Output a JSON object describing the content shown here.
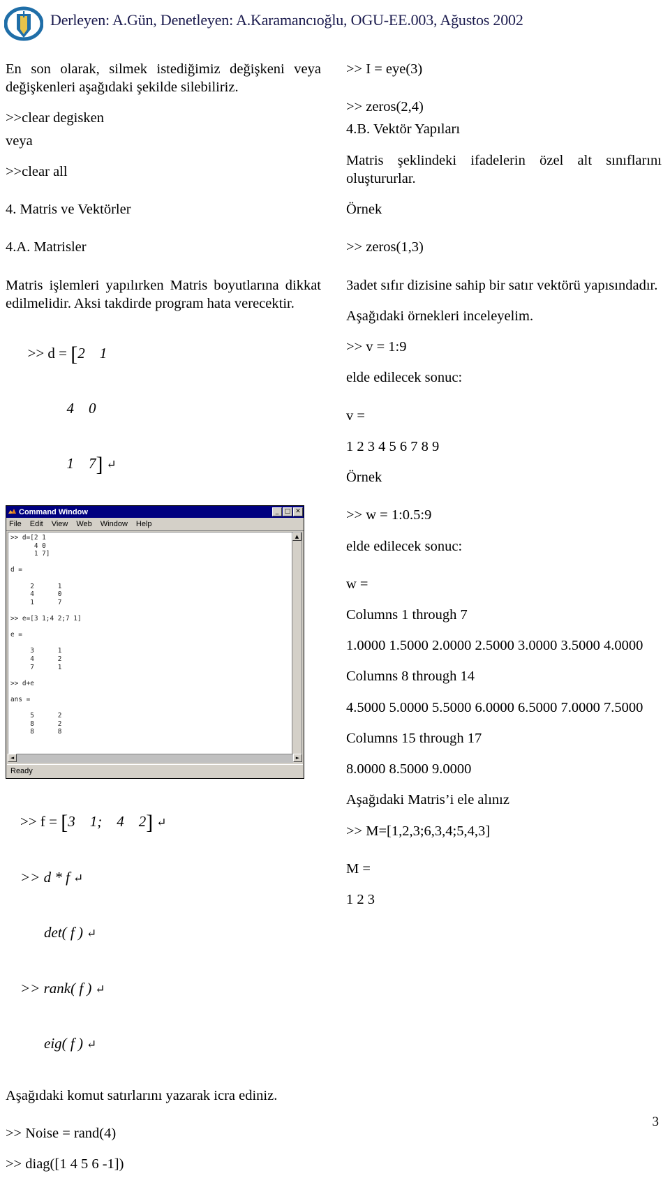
{
  "header": {
    "logo_icon": "pen-in-oval-logo",
    "title": "Derleyen: A.Gün, Denetleyen: A.Karamancıoğlu, OGU-EE.003, Ağustos 2002",
    "title_color": "#1a1a4d"
  },
  "left_column": {
    "intro_paragraph": "En son olarak, silmek istediğimiz değişkeni veya değişkenleri aşağıdaki şekilde silebiliriz.",
    "cmd_clear_degisken": ">>clear degisken",
    "veya": "veya",
    "cmd_clear_all": ">>clear all",
    "heading_4": "4. Matris ve Vektörler",
    "heading_4a": "4.A. Matrisler",
    "matris_paragraph": "Matris işlemleri yapılırken Matris boyutlarına dikkat edilmelidir. Aksi takdirde program hata verecektir.",
    "matrix_d": {
      "line1_prefix": ">> d = ",
      "bracket_open": "[",
      "row1": "2    1",
      "row2": "4    0",
      "row3": "1    7",
      "bracket_close": "]",
      "return_glyph": "↵"
    },
    "cmd_e": {
      "prefix": ">> e = ",
      "bracket_open": "[",
      "content": "3    1;    4    2;    7    1",
      "bracket_close": "]",
      "return_glyph": "↵"
    },
    "cmd_dplus_e": ">> d + e",
    "cmd_f": {
      "prefix": ">> f = ",
      "bracket_open": "[",
      "content": "3    1;    4    2",
      "bracket_close": "]",
      "return_glyph": "↵"
    },
    "cmd_dtimesf": ">> d * f",
    "cmd_det": "det( f )",
    "cmd_rank": ">> rank( f )",
    "cmd_eig": "eig( f )",
    "komut_paragraph": "Aşağıdaki komut satırlarını yazarak icra ediniz.",
    "cmd_noise": ">> Noise = rand(4)",
    "cmd_diag": ">> diag([1 4 5 6 -1])"
  },
  "matlab_window": {
    "icon": "matlab-membrane-icon",
    "title": "Command Window",
    "minimize_label": "_",
    "maximize_label": "□",
    "close_label": "✕",
    "menus": [
      "File",
      "Edit",
      "View",
      "Web",
      "Window",
      "Help"
    ],
    "console_text": ">> d=[2 1\n      4 0\n      1 7]\n\nd =\n\n     2      1\n     4      0\n     1      7\n\n>> e=[3 1;4 2;7 1]\n\ne =\n\n     3      1\n     4      2\n     7      1\n\n>> d+e\n\nans =\n\n     5      2\n     8      2\n     8      8\n",
    "scroll_up_glyph": "▲",
    "scroll_down_glyph": "▼",
    "scroll_left_glyph": "◄",
    "scroll_right_glyph": "►",
    "status_text": "Ready"
  },
  "right_column": {
    "cmd_eye": ">> I = eye(3)",
    "cmd_zeros24": ">> zeros(2,4)",
    "heading_4b": "4.B. Vektör Yapıları",
    "matris_alt_paragraph": "Matris şeklindeki ifadelerin özel alt sınıflarını oluştururlar.",
    "ornek_1": "Örnek",
    "cmd_zeros13": ">> zeros(1,3)",
    "adet_paragraph": "3adet   sıfır dizisine sahip bir satır vektörü yapısındadır.",
    "asagidaki_paragraph": "Aşağıdaki örnekleri inceleyelim.",
    "cmd_v": ">> v = 1:9",
    "elde_1": "elde edilecek sonuc:",
    "v_label": "v =",
    "v_values": "1 2 3 4 5 6 7 8 9",
    "ornek_2": "Örnek",
    "cmd_w": ">> w = 1:0.5:9",
    "elde_2": "elde edilecek sonuc:",
    "w_label": "w =",
    "columns_1_7": "Columns 1 through 7",
    "w_values_1": "1.0000  1.5000  2.0000  2.5000  3.0000  3.5000 4.0000",
    "columns_8_14": "Columns 8 through 14",
    "w_values_2": "4.5000  5.0000  5.5000  6.0000  6.5000  7.0000 7.5000",
    "columns_15_17": "Columns 15 through 17",
    "w_values_3": "8.0000 8.5000 9.0000",
    "matris_ele_paragraph": "Aşağıdaki Matris’i ele alınız",
    "cmd_M": ">> M=[1,2,3;6,3,4;5,4,3]",
    "M_label": "M =",
    "M_row1": "1 2 3"
  },
  "footer": {
    "page_number": "3"
  }
}
